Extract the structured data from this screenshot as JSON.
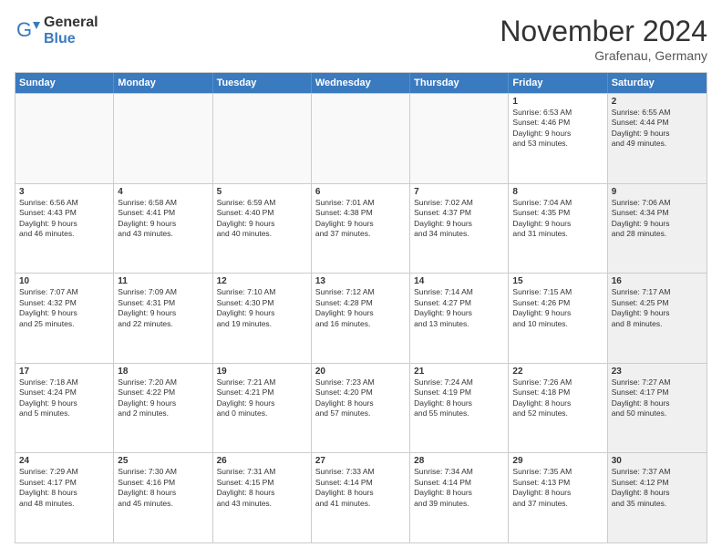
{
  "logo": {
    "general": "General",
    "blue": "Blue"
  },
  "title": "November 2024",
  "subtitle": "Grafenau, Germany",
  "header_days": [
    "Sunday",
    "Monday",
    "Tuesday",
    "Wednesday",
    "Thursday",
    "Friday",
    "Saturday"
  ],
  "weeks": [
    [
      {
        "day": "",
        "info": "",
        "empty": true
      },
      {
        "day": "",
        "info": "",
        "empty": true
      },
      {
        "day": "",
        "info": "",
        "empty": true
      },
      {
        "day": "",
        "info": "",
        "empty": true
      },
      {
        "day": "",
        "info": "",
        "empty": true
      },
      {
        "day": "1",
        "info": "Sunrise: 6:53 AM\nSunset: 4:46 PM\nDaylight: 9 hours\nand 53 minutes."
      },
      {
        "day": "2",
        "info": "Sunrise: 6:55 AM\nSunset: 4:44 PM\nDaylight: 9 hours\nand 49 minutes.",
        "shaded": true
      }
    ],
    [
      {
        "day": "3",
        "info": "Sunrise: 6:56 AM\nSunset: 4:43 PM\nDaylight: 9 hours\nand 46 minutes."
      },
      {
        "day": "4",
        "info": "Sunrise: 6:58 AM\nSunset: 4:41 PM\nDaylight: 9 hours\nand 43 minutes."
      },
      {
        "day": "5",
        "info": "Sunrise: 6:59 AM\nSunset: 4:40 PM\nDaylight: 9 hours\nand 40 minutes."
      },
      {
        "day": "6",
        "info": "Sunrise: 7:01 AM\nSunset: 4:38 PM\nDaylight: 9 hours\nand 37 minutes."
      },
      {
        "day": "7",
        "info": "Sunrise: 7:02 AM\nSunset: 4:37 PM\nDaylight: 9 hours\nand 34 minutes."
      },
      {
        "day": "8",
        "info": "Sunrise: 7:04 AM\nSunset: 4:35 PM\nDaylight: 9 hours\nand 31 minutes."
      },
      {
        "day": "9",
        "info": "Sunrise: 7:06 AM\nSunset: 4:34 PM\nDaylight: 9 hours\nand 28 minutes.",
        "shaded": true
      }
    ],
    [
      {
        "day": "10",
        "info": "Sunrise: 7:07 AM\nSunset: 4:32 PM\nDaylight: 9 hours\nand 25 minutes."
      },
      {
        "day": "11",
        "info": "Sunrise: 7:09 AM\nSunset: 4:31 PM\nDaylight: 9 hours\nand 22 minutes."
      },
      {
        "day": "12",
        "info": "Sunrise: 7:10 AM\nSunset: 4:30 PM\nDaylight: 9 hours\nand 19 minutes."
      },
      {
        "day": "13",
        "info": "Sunrise: 7:12 AM\nSunset: 4:28 PM\nDaylight: 9 hours\nand 16 minutes."
      },
      {
        "day": "14",
        "info": "Sunrise: 7:14 AM\nSunset: 4:27 PM\nDaylight: 9 hours\nand 13 minutes."
      },
      {
        "day": "15",
        "info": "Sunrise: 7:15 AM\nSunset: 4:26 PM\nDaylight: 9 hours\nand 10 minutes."
      },
      {
        "day": "16",
        "info": "Sunrise: 7:17 AM\nSunset: 4:25 PM\nDaylight: 9 hours\nand 8 minutes.",
        "shaded": true
      }
    ],
    [
      {
        "day": "17",
        "info": "Sunrise: 7:18 AM\nSunset: 4:24 PM\nDaylight: 9 hours\nand 5 minutes."
      },
      {
        "day": "18",
        "info": "Sunrise: 7:20 AM\nSunset: 4:22 PM\nDaylight: 9 hours\nand 2 minutes."
      },
      {
        "day": "19",
        "info": "Sunrise: 7:21 AM\nSunset: 4:21 PM\nDaylight: 9 hours\nand 0 minutes."
      },
      {
        "day": "20",
        "info": "Sunrise: 7:23 AM\nSunset: 4:20 PM\nDaylight: 8 hours\nand 57 minutes."
      },
      {
        "day": "21",
        "info": "Sunrise: 7:24 AM\nSunset: 4:19 PM\nDaylight: 8 hours\nand 55 minutes."
      },
      {
        "day": "22",
        "info": "Sunrise: 7:26 AM\nSunset: 4:18 PM\nDaylight: 8 hours\nand 52 minutes."
      },
      {
        "day": "23",
        "info": "Sunrise: 7:27 AM\nSunset: 4:17 PM\nDaylight: 8 hours\nand 50 minutes.",
        "shaded": true
      }
    ],
    [
      {
        "day": "24",
        "info": "Sunrise: 7:29 AM\nSunset: 4:17 PM\nDaylight: 8 hours\nand 48 minutes."
      },
      {
        "day": "25",
        "info": "Sunrise: 7:30 AM\nSunset: 4:16 PM\nDaylight: 8 hours\nand 45 minutes."
      },
      {
        "day": "26",
        "info": "Sunrise: 7:31 AM\nSunset: 4:15 PM\nDaylight: 8 hours\nand 43 minutes."
      },
      {
        "day": "27",
        "info": "Sunrise: 7:33 AM\nSunset: 4:14 PM\nDaylight: 8 hours\nand 41 minutes."
      },
      {
        "day": "28",
        "info": "Sunrise: 7:34 AM\nSunset: 4:14 PM\nDaylight: 8 hours\nand 39 minutes."
      },
      {
        "day": "29",
        "info": "Sunrise: 7:35 AM\nSunset: 4:13 PM\nDaylight: 8 hours\nand 37 minutes."
      },
      {
        "day": "30",
        "info": "Sunrise: 7:37 AM\nSunset: 4:12 PM\nDaylight: 8 hours\nand 35 minutes.",
        "shaded": true
      }
    ]
  ]
}
